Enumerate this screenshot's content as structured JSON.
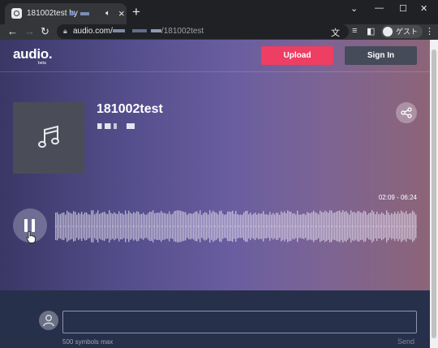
{
  "browser": {
    "tab_title": "181002test by",
    "url_host": "audio.com/",
    "url_path": "/181002test",
    "profile_label": "ゲスト"
  },
  "site": {
    "logo": "audio.",
    "logo_sub": "beta",
    "upload_label": "Upload",
    "signin_label": "Sign In"
  },
  "track": {
    "title": "181002test",
    "time_display": "02:09 - 06:24",
    "progress": 0.335
  },
  "comments": {
    "placeholder": "",
    "limit_text": "500 symbols max",
    "send_label": "Send"
  },
  "colors": {
    "upload": "#ee3e63",
    "signin": "#454b59",
    "played_wave": "#c9c3dc",
    "unplayed_wave": "#ddd6ea"
  }
}
